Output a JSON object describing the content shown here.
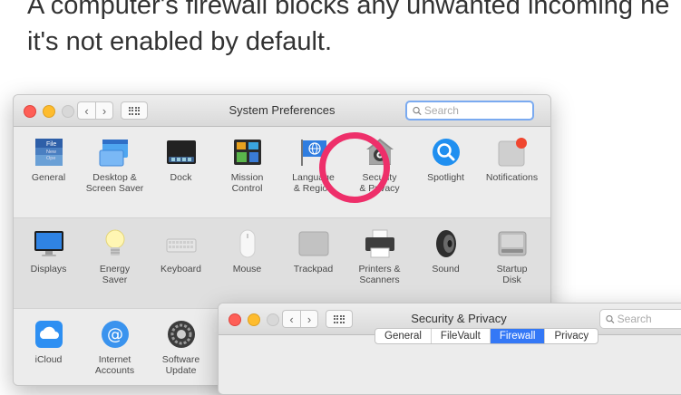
{
  "headline": "A computer's firewall blocks any unwanted incoming ne\nit's not enabled by default.",
  "main_window": {
    "title": "System Preferences",
    "search_placeholder": "Search",
    "nav": {
      "back": "‹",
      "forward": "›"
    },
    "rows": [
      [
        {
          "key": "general",
          "label": "General",
          "icon_detail": "File\nNew\nOpe"
        },
        {
          "key": "desktop",
          "label": "Desktop &\nScreen Saver"
        },
        {
          "key": "dock",
          "label": "Dock"
        },
        {
          "key": "mission",
          "label": "Mission\nControl"
        },
        {
          "key": "language",
          "label": "Language\n& Region",
          "icon_glyph": "⊕"
        },
        {
          "key": "security",
          "label": "Security\n& Privacy"
        },
        {
          "key": "spotlight",
          "label": "Spotlight"
        },
        {
          "key": "notifications",
          "label": "Notifications"
        }
      ],
      [
        {
          "key": "displays",
          "label": "Displays"
        },
        {
          "key": "energy",
          "label": "Energy\nSaver"
        },
        {
          "key": "keyboard",
          "label": "Keyboard"
        },
        {
          "key": "mouse",
          "label": "Mouse"
        },
        {
          "key": "trackpad",
          "label": "Trackpad"
        },
        {
          "key": "printers",
          "label": "Printers &\nScanners"
        },
        {
          "key": "sound",
          "label": "Sound"
        },
        {
          "key": "startup",
          "label": "Startup\nDisk"
        }
      ],
      [
        {
          "key": "icloud",
          "label": "iCloud"
        },
        {
          "key": "internet",
          "label": "Internet\nAccounts",
          "icon_glyph": "@"
        },
        {
          "key": "software",
          "label": "Software\nUpdate"
        }
      ]
    ]
  },
  "security_window": {
    "title": "Security & Privacy",
    "search_placeholder": "Search",
    "nav": {
      "back": "‹",
      "forward": "›"
    },
    "tabs": [
      {
        "label": "General",
        "active": false
      },
      {
        "label": "FileVault",
        "active": false
      },
      {
        "label": "Firewall",
        "active": true
      },
      {
        "label": "Privacy",
        "active": false
      }
    ]
  },
  "colors": {
    "highlight_ring": "#ee2f6a",
    "active_tab": "#3478f6",
    "search_focus": "#7aaaf0"
  }
}
